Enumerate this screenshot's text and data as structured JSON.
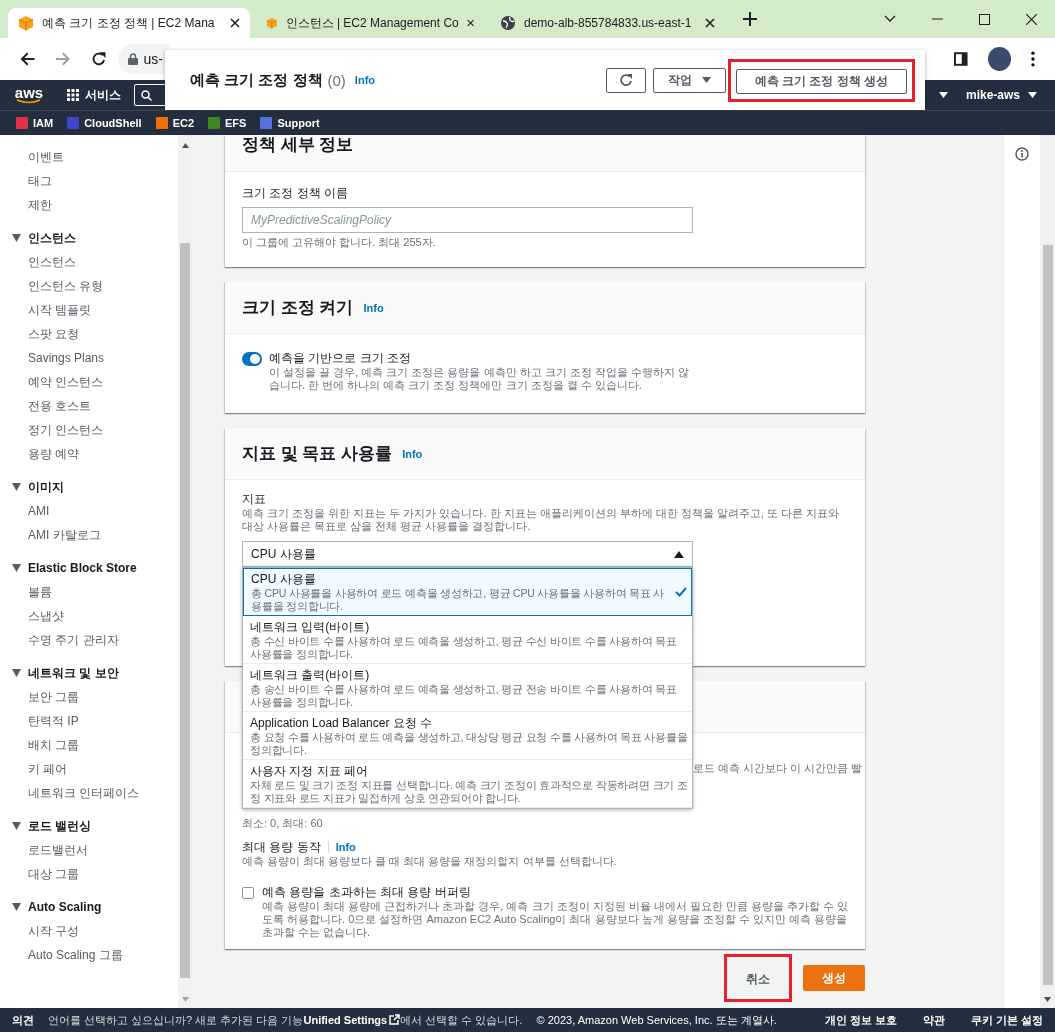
{
  "browser": {
    "tabs": [
      {
        "title": "예측 크기 조정 정책 | EC2 Mana",
        "kind": "box",
        "selected": true
      },
      {
        "title": "인스턴스 | EC2 Management Co",
        "kind": "box",
        "selected": false
      },
      {
        "title": "demo-alb-855784833.us-east-1",
        "kind": "globe",
        "selected": false
      }
    ],
    "url": "us-"
  },
  "console_nav": {
    "logo": "aws",
    "services": "서비스",
    "account": "mike-aws"
  },
  "favorites": [
    {
      "label": "IAM",
      "color": "#dd344c"
    },
    {
      "label": "CloudShell",
      "color": "#3f48cc"
    },
    {
      "label": "EC2",
      "color": "#ed7100"
    },
    {
      "label": "EFS",
      "color": "#3f8624"
    },
    {
      "label": "Support",
      "color": "#5a6fe0"
    }
  ],
  "page_header": {
    "title": "예측 크기 조정 정책",
    "count": "(0)",
    "info": "Info",
    "actions_button": "작업",
    "create_button": "예측 크기 조정 정책 생성",
    "create_highlighted": true
  },
  "sidebar": {
    "items": [
      "이벤트",
      "태그",
      "제한"
    ],
    "groups": [
      {
        "label": "인스턴스",
        "expanded": true,
        "items": [
          "인스턴스",
          "인스턴스 유형",
          "시작 템플릿",
          "스팟 요청",
          "Savings Plans",
          "예약 인스턴스",
          "전용 호스트",
          "정기 인스턴스",
          "용량 예약"
        ]
      },
      {
        "label": "이미지",
        "expanded": true,
        "items": [
          "AMI",
          "AMI 카탈로그"
        ]
      },
      {
        "label": "Elastic Block Store",
        "expanded": true,
        "items": [
          "볼륨",
          "스냅샷",
          "수명 주기 관리자"
        ]
      },
      {
        "label": "네트워크 및 보안",
        "expanded": true,
        "items": [
          "보안 그룹",
          "탄력적 IP",
          "배치 그룹",
          "키 페어",
          "네트워크 인터페이스"
        ]
      },
      {
        "label": "로드 밸런싱",
        "expanded": true,
        "items": [
          "로드밸런서",
          "대상 그룹"
        ]
      },
      {
        "label": "Auto Scaling",
        "expanded": true,
        "items": [
          "시작 구성",
          "Auto Scaling 그룹"
        ]
      }
    ]
  },
  "sections": [
    {
      "kind": "name",
      "title": "정책 세부 정보",
      "label": "크기 조정 정책 이름",
      "placeholder": "MyPredictiveScalingPolicy",
      "hint": "이 그룹에 고유해야 합니다. 최대 255자."
    },
    {
      "kind": "toggle",
      "title": "크기 조정 켜기",
      "info": "Info",
      "toggle_label": "예측을 기반으로 크기 조정",
      "toggle_description": "이 설정을 끌 경우, 예측 크기 조정은 용량을 예측만 하고 크기 조정 작업을 수행하지 않습니다. 한 번에 하나의 예측 크기 조정 정책에만 크기 조정을 켤 수 있습니다.",
      "on": true
    },
    {
      "kind": "metric",
      "title": "지표 및 목표 사용률",
      "info": "Info",
      "label": "지표",
      "description": "예측 크기 조정을 위한 지표는 두 가지가 있습니다. 한 지표는 애플리케이션의 부하에 대한 정책을 알려주고, 또 다른 지표와 대상 사용률은 목표로 삼을 전체 평균 사용률을 결정합니다.",
      "select_value": "CPU 사용률",
      "expanded": true,
      "options": [
        {
          "title": "CPU 사용률",
          "description": "총 CPU 사용률을 사용하여 로드 예측을 생성하고, 평균 CPU 사용률을 사용하여 목표 사용률을 정의합니다.",
          "selected": true
        },
        {
          "title": "네트워크 입력(바이트)",
          "description": "총 수신 바이트 수를 사용하여 로드 예측을 생성하고, 평균 수신 바이트 수를 사용하여 목표 사용률을 정의합니다.",
          "selected": false
        },
        {
          "title": "네트워크 출력(바이트)",
          "description": "총 송신 바이트 수를 사용하여 로드 예측을 생성하고, 평균 전송 바이트 수를 사용하여 목표 사용률을 정의합니다.",
          "selected": false
        },
        {
          "title": "Application Load Balancer 요청 수",
          "description": "총 요청 수를 사용하여 로드 예측을 생성하고, 대상당 평균 요청 수를 사용하여 목표 사용률을 정의합니다.",
          "selected": false
        },
        {
          "title": "사용자 지정 지표 페어",
          "description": "자체 로드 및 크기 조정 지표를 선택합니다. 예측 크기 조정이 효과적으로 작동하려면 크기 조정 지표와 로드 지표가 밀접하게 상호 연관되어야 합니다.",
          "selected": false
        }
      ]
    },
    {
      "kind": "capacity",
      "partial_text": "로드 예측 시간보다 이 시간만큼 빨",
      "range_hint": "최소: 0, 최대: 60",
      "behavior_label": "최대 용량 동작",
      "info": "Info",
      "behavior_description": "예측 용량이 최대 용량보다 클 때 최대 용량을 재정의할지 여부를 선택합니다.",
      "buffer_label": "예측 용량을 초과하는 최대 용량 버퍼링",
      "buffer_description": "예측 용량이 최대 용량에 근접하거나 초과할 경우, 예측 크기 조정이 지정된 비율 내에서 필요한 만큼 용량을 추가할 수 있도록 허용합니다. 0으로 설정하면 Amazon EC2 Auto Scaling이 최대 용량보다 높게 용량을 조정할 수 있지만 예측 용량을 초과할 수는 없습니다.",
      "checked": false
    }
  ],
  "actions": {
    "cancel": "취소",
    "cancel_highlighted": true,
    "create": "생성"
  },
  "footer": {
    "feedback": "의견",
    "notice_before": "언어를 선택하고 싶으십니까? 새로 추가된 다음 기능",
    "link": "Unified Settings",
    "notice_after": "에서 선택할 수 있습니다.",
    "copyright": "© 2023, Amazon Web Services, Inc. 또는 계열사.",
    "links": [
      "개인 정보 보호",
      "약관",
      "쿠키 기본 설정"
    ]
  }
}
